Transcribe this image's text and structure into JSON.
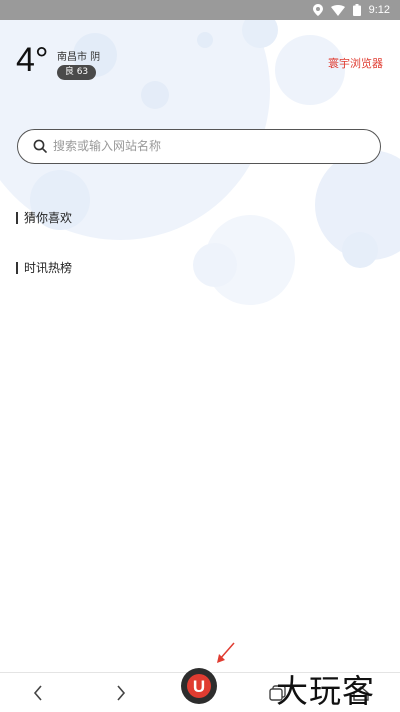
{
  "status_bar": {
    "time": "9:12"
  },
  "weather": {
    "temperature": "4°",
    "city_condition": "南昌市 阴",
    "aqi": "良 63"
  },
  "header": {
    "browser_name": "寰宇浏览器"
  },
  "search": {
    "placeholder": "搜索或输入网站名称",
    "value": ""
  },
  "sections": {
    "guess_you_like": "猜你喜欢",
    "news_hot": "时讯热榜"
  },
  "bottom_nav": {
    "logo_letter": "U"
  },
  "watermark": {
    "text": "大玩客"
  },
  "colors": {
    "accent_red": "#e03c31",
    "status_bar": "#9a9a9a",
    "logo_red": "#e03c31"
  }
}
